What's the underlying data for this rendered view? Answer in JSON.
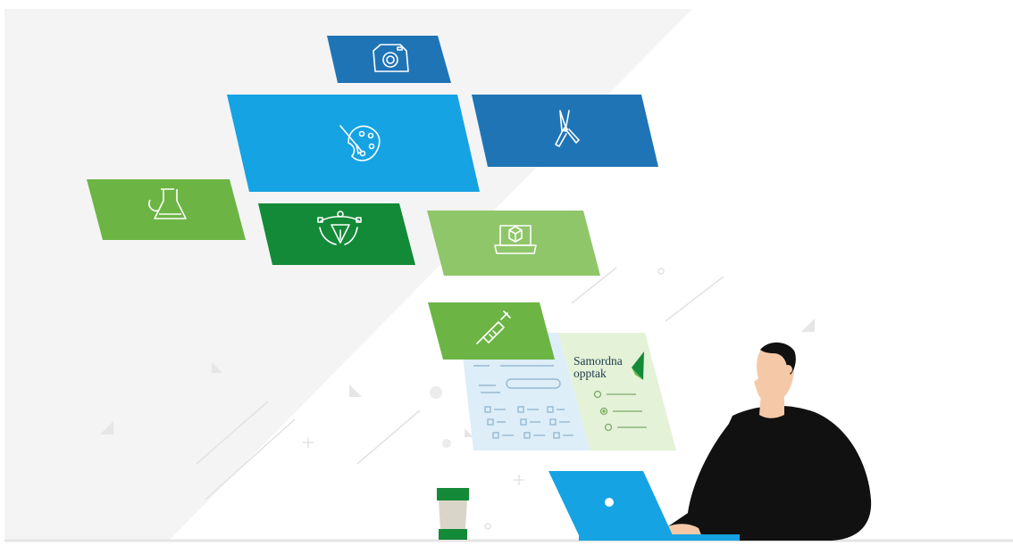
{
  "illustration": {
    "form_card": {
      "title_line1": "Samordna",
      "title_line2": "opptak"
    }
  },
  "tiles": [
    {
      "icon": "camera-icon",
      "color": "#1f74b6"
    },
    {
      "icon": "palette-icon",
      "color": "#15a3e3"
    },
    {
      "icon": "pruning-shears-icon",
      "color": "#1f74b6"
    },
    {
      "icon": "flask-icon",
      "color": "#6cb545"
    },
    {
      "icon": "pen-tool-icon",
      "color": "#138a37"
    },
    {
      "icon": "laptop-3d-icon",
      "color": "#8fc66a"
    },
    {
      "icon": "syringe-icon",
      "color": "#6cb545"
    }
  ],
  "colors": {
    "background": "#f4f4f4",
    "brand_green": "#138a37",
    "laptop_blue": "#15a3e3",
    "sweater": "#111111",
    "skin": "#f5c9a8"
  }
}
